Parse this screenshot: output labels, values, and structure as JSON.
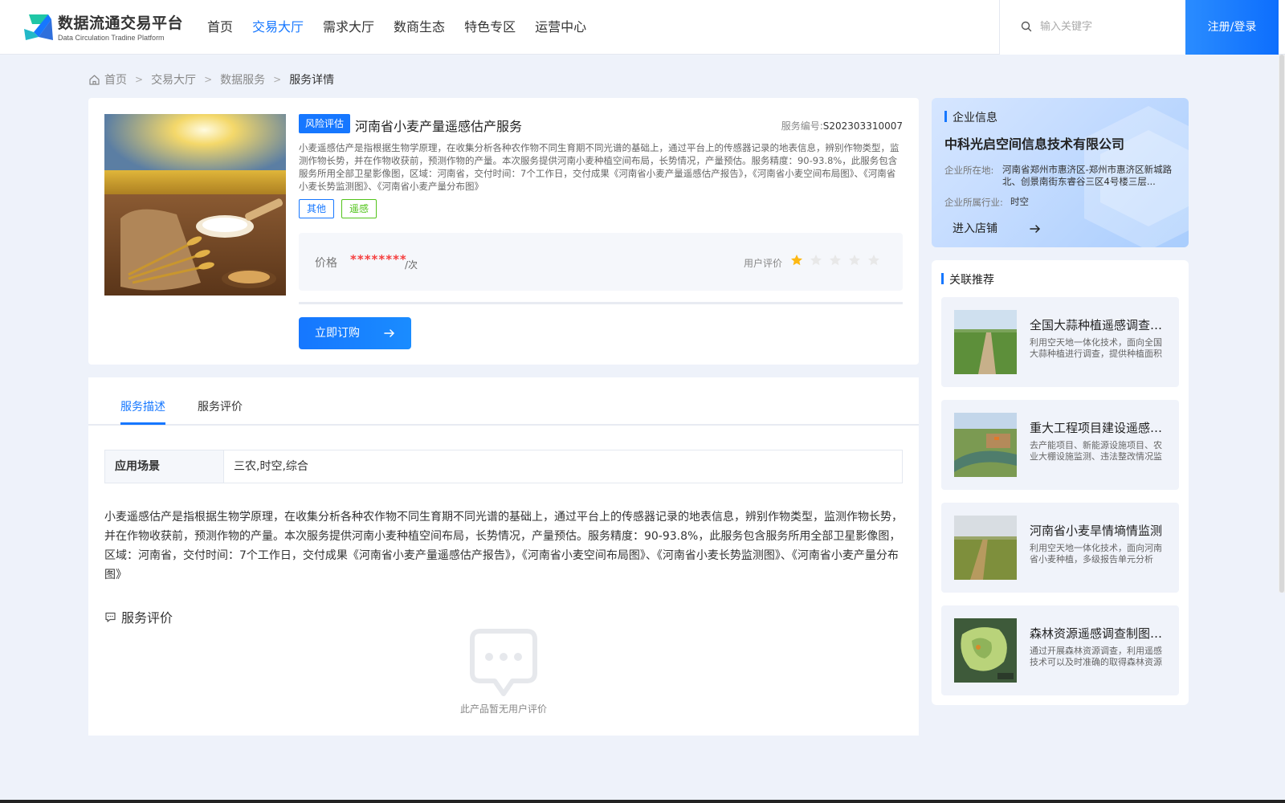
{
  "header": {
    "logo_title": "数据流通交易平台",
    "logo_subtitle": "Data Circulation Tradine Platform",
    "nav": [
      {
        "label": "首页",
        "active": false
      },
      {
        "label": "交易大厅",
        "active": true
      },
      {
        "label": "需求大厅",
        "active": false
      },
      {
        "label": "数商生态",
        "active": false
      },
      {
        "label": "特色专区",
        "active": false
      },
      {
        "label": "运营中心",
        "active": false
      }
    ],
    "search_placeholder": "输入关键字",
    "login_label": "注册/登录"
  },
  "breadcrumb": {
    "items": [
      "首页",
      "交易大厅",
      "数据服务"
    ],
    "current": "服务详情"
  },
  "product": {
    "category_tag": "风险评估",
    "title": "河南省小麦产量遥感估产服务",
    "service_no_label": "服务编号:",
    "service_no": "S202303310007",
    "description": "小麦遥感估产是指根据生物学原理，在收集分析各种农作物不同生育期不同光谱的基础上，通过平台上的传感器记录的地表信息，辨别作物类型，监测作物长势，并在作物收获前，预测作物的产量。本次服务提供河南小麦种植空间布局，长势情况，产量预估。服务精度：90-93.8%，此服务包含服务所用全部卫星影像图，区域：河南省，交付时间：7个工作日，交付成果《河南省小麦产量遥感估产报告》，《河南省小麦空间布局图》、《河南省小麦长势监测图》、《河南省小麦产量分布图》",
    "tags": [
      "其他",
      "遥感"
    ],
    "price_label": "价格",
    "price_value": "********",
    "price_unit": "/次",
    "rating_label": "用户评价",
    "rating": 1,
    "rating_max": 5,
    "buy_label": "立即订购"
  },
  "detail": {
    "tabs": [
      {
        "label": "服务描述",
        "active": true
      },
      {
        "label": "服务评价",
        "active": false
      }
    ],
    "scene_label": "应用场景",
    "scene_value": "三农,时空,综合",
    "text": "小麦遥感估产是指根据生物学原理，在收集分析各种农作物不同生育期不同光谱的基础上，通过平台上的传感器记录的地表信息，辨别作物类型，监测作物长势，并在作物收获前，预测作物的产量。本次服务提供河南小麦种植空间布局，长势情况，产量预估。服务精度：90-93.8%，此服务包含服务所用全部卫星影像图，区域：河南省，交付时间：7个工作日，交付成果《河南省小麦产量遥感估产报告》，《河南省小麦空间布局图》、《河南省小麦长势监测图》、《河南省小麦产量分布图》",
    "review_heading": "服务评价",
    "empty_text": "此产品暂无用户评价"
  },
  "company": {
    "section_title": "企业信息",
    "name": "中科光启空间信息技术有限公司",
    "location_label": "企业所在地:",
    "location": "河南省郑州市惠济区-郑州市惠济区新城路北、创景南街东睿谷三区4号楼三层...",
    "industry_label": "企业所属行业:",
    "industry": "时空",
    "shop_link": "进入店铺"
  },
  "recommend": {
    "section_title": "关联推荐",
    "items": [
      {
        "title": "全国大蒜种植遥感调查服务",
        "desc": "利用空天地一体化技术，面向全国大蒜种植进行调查，提供种植面积分布数据"
      },
      {
        "title": "重大工程项目建设遥感监测",
        "desc": "去产能项目、新能源设施项目、农业大棚设施监测、违法整改情况监测等"
      },
      {
        "title": "河南省小麦旱情墒情监测",
        "desc": "利用空天地一体化技术，面向河南省小麦种植，多级报告单元分析"
      },
      {
        "title": "森林资源遥感调查制图服务",
        "desc": "通过开展森林资源调查，利用遥感技术可以及时准确的取得森林资源信息"
      }
    ]
  },
  "colors": {
    "accent": "#1677ff",
    "price": "#f53f3f",
    "star_active": "#fdb813",
    "star_inactive": "#e8e8e8"
  }
}
